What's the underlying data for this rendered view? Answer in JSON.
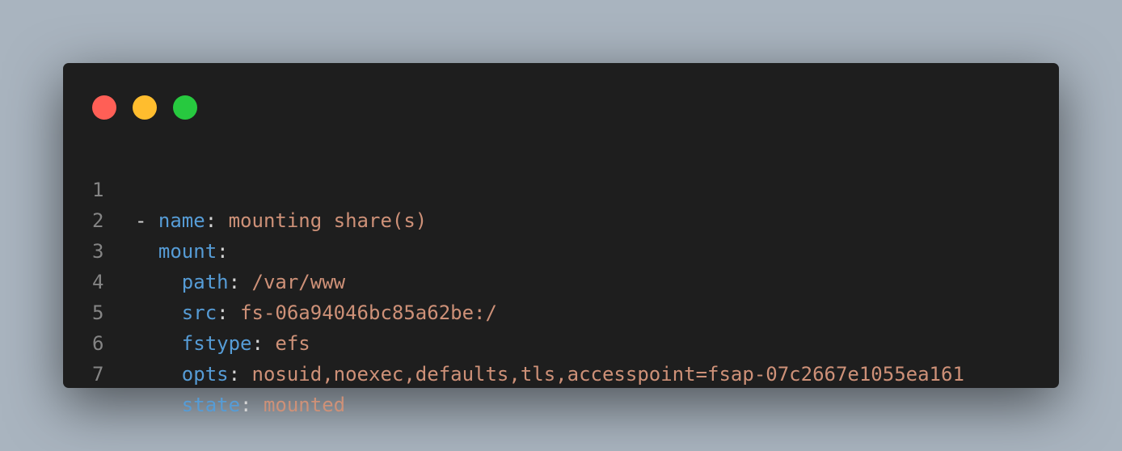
{
  "window": {
    "controls": {
      "close_color": "#ff5f56",
      "minimize_color": "#ffbd2e",
      "maximize_color": "#27c93f"
    }
  },
  "code": {
    "language": "yaml",
    "lines": [
      {
        "number": "1",
        "indent": "",
        "prefix": "- ",
        "key": "name",
        "sep": ": ",
        "value": "mounting share(s)"
      },
      {
        "number": "2",
        "indent": "  ",
        "prefix": "",
        "key": "mount",
        "sep": ":",
        "value": ""
      },
      {
        "number": "3",
        "indent": "    ",
        "prefix": "",
        "key": "path",
        "sep": ": ",
        "value": "/var/www"
      },
      {
        "number": "4",
        "indent": "    ",
        "prefix": "",
        "key": "src",
        "sep": ": ",
        "value": "fs-06a94046bc85a62be:/"
      },
      {
        "number": "5",
        "indent": "    ",
        "prefix": "",
        "key": "fstype",
        "sep": ": ",
        "value": "efs"
      },
      {
        "number": "6",
        "indent": "    ",
        "prefix": "",
        "key": "opts",
        "sep": ": ",
        "value": "nosuid,noexec,defaults,tls,accesspoint=fsap-07c2667e1055ea161"
      },
      {
        "number": "7",
        "indent": "    ",
        "prefix": "",
        "key": "state",
        "sep": ": ",
        "value": "mounted"
      }
    ],
    "colors": {
      "key": "#569cd6",
      "value": "#ce9178",
      "punctuation": "#d4d4d4",
      "line_number": "#858585",
      "background": "#1e1e1e"
    }
  }
}
